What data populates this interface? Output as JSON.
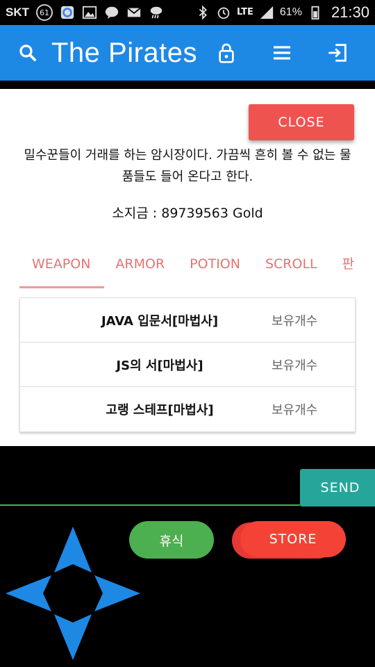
{
  "statusbar": {
    "carrier": "SKT",
    "notif_count": "61",
    "lte": "LTE",
    "battery": "61%",
    "time": "21:30"
  },
  "appbar": {
    "title": "The Pirates",
    "icons": [
      "search-icon",
      "lock-icon",
      "menu-icon",
      "exit-icon"
    ],
    "color": "#1e88e5"
  },
  "store": {
    "close_label": "CLOSE",
    "description": "밀수꾼들이 거래를 하는 암시장이다. 가끔씩 흔히 볼 수 없는 물품들도 들어 온다고 한다.",
    "gold_text": "소지금 : 89739563 Gold",
    "tabs": [
      {
        "label": "WEAPON",
        "active": true
      },
      {
        "label": "ARMOR",
        "active": false
      },
      {
        "label": "POTION",
        "active": false
      },
      {
        "label": "SCROLL",
        "active": false
      },
      {
        "label": "판",
        "active": false
      }
    ],
    "items": [
      {
        "name": "JAVA 입문서[마법사]",
        "qty_label": "보유개수"
      },
      {
        "name": "JS의 서[마법사]",
        "qty_label": "보유개수"
      },
      {
        "name": "고랭 스테프[마법사]",
        "qty_label": "보유개수"
      }
    ]
  },
  "chat": {
    "input_value": "",
    "send_label": "SEND"
  },
  "actions": {
    "rest_label": "휴식",
    "store_label": "STORE"
  },
  "dpad": {
    "color": "#1e88e5",
    "directions": [
      "up",
      "down",
      "left",
      "right"
    ]
  }
}
